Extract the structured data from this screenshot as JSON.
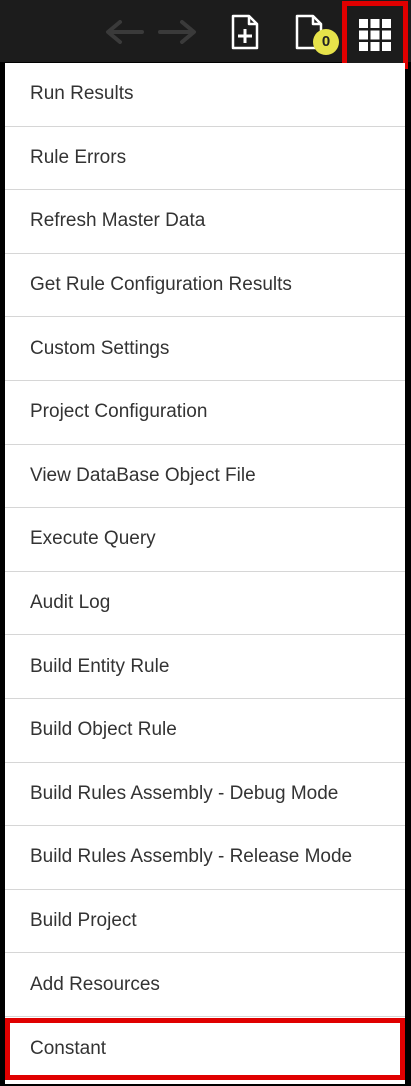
{
  "toolbar": {
    "icons": {
      "back": "arrow-left-icon",
      "forward": "arrow-right-icon",
      "new_file": "file-plus-icon",
      "files": "file-icon",
      "apps": "grid-icon"
    },
    "files_badge_count": "0",
    "colors": {
      "background": "#1c1c1c",
      "badge": "#e6e24a",
      "highlight": "#e00000"
    }
  },
  "menu": {
    "items": [
      {
        "label": "Run Results"
      },
      {
        "label": "Rule Errors"
      },
      {
        "label": "Refresh Master Data"
      },
      {
        "label": "Get Rule Configuration Results"
      },
      {
        "label": "Custom Settings"
      },
      {
        "label": "Project Configuration"
      },
      {
        "label": "View DataBase Object File"
      },
      {
        "label": "Execute Query"
      },
      {
        "label": "Audit Log"
      },
      {
        "label": "Build Entity Rule"
      },
      {
        "label": "Build Object Rule"
      },
      {
        "label": "Build Rules Assembly - Debug Mode"
      },
      {
        "label": "Build Rules Assembly - Release Mode"
      },
      {
        "label": "Build Project"
      },
      {
        "label": "Add Resources"
      },
      {
        "label": "Constant"
      }
    ],
    "highlighted_item": "Constant"
  }
}
